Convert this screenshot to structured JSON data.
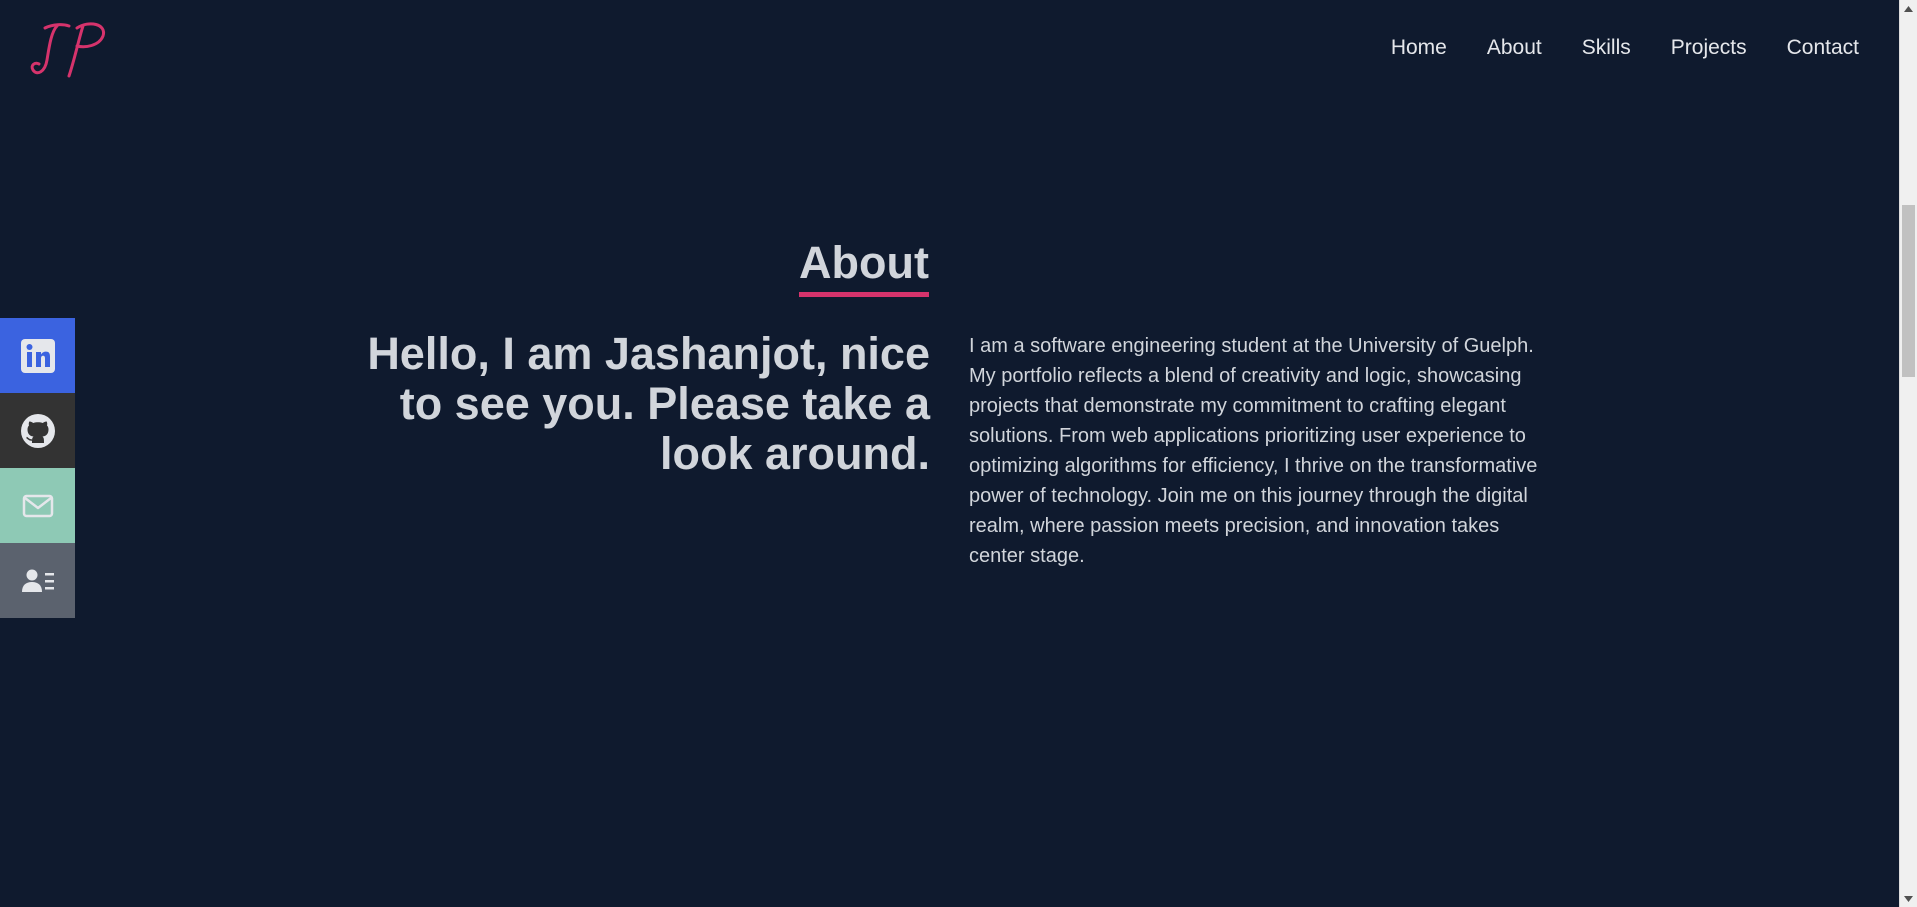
{
  "header": {
    "logo_text": "JP",
    "nav": [
      {
        "label": "Home"
      },
      {
        "label": "About"
      },
      {
        "label": "Skills"
      },
      {
        "label": "Projects"
      },
      {
        "label": "Contact"
      }
    ]
  },
  "social": [
    {
      "icon": "linkedin-icon",
      "color": "#3b63e0"
    },
    {
      "icon": "github-icon",
      "color": "#333333"
    },
    {
      "icon": "mail-icon",
      "color": "#8ec9b5"
    },
    {
      "icon": "resume-icon",
      "color": "#5b626e"
    }
  ],
  "about": {
    "title": "About",
    "hello": "Hello, I am Jashanjot, nice to see you. Please take a look around.",
    "bio": "I am a software engineering student at the University of Guelph. My portfolio reflects a blend of creativity and logic, showcasing projects that demonstrate my commitment to crafting elegant solutions. From web applications prioritizing user experience to optimizing algorithms for efficiency, I thrive on the transformative power of technology. Join me on this journey through the digital realm, where passion meets precision, and innovation takes center stage."
  },
  "colors": {
    "background": "#0f1a2e",
    "accent": "#d6336c",
    "text": "#d1d5db"
  }
}
